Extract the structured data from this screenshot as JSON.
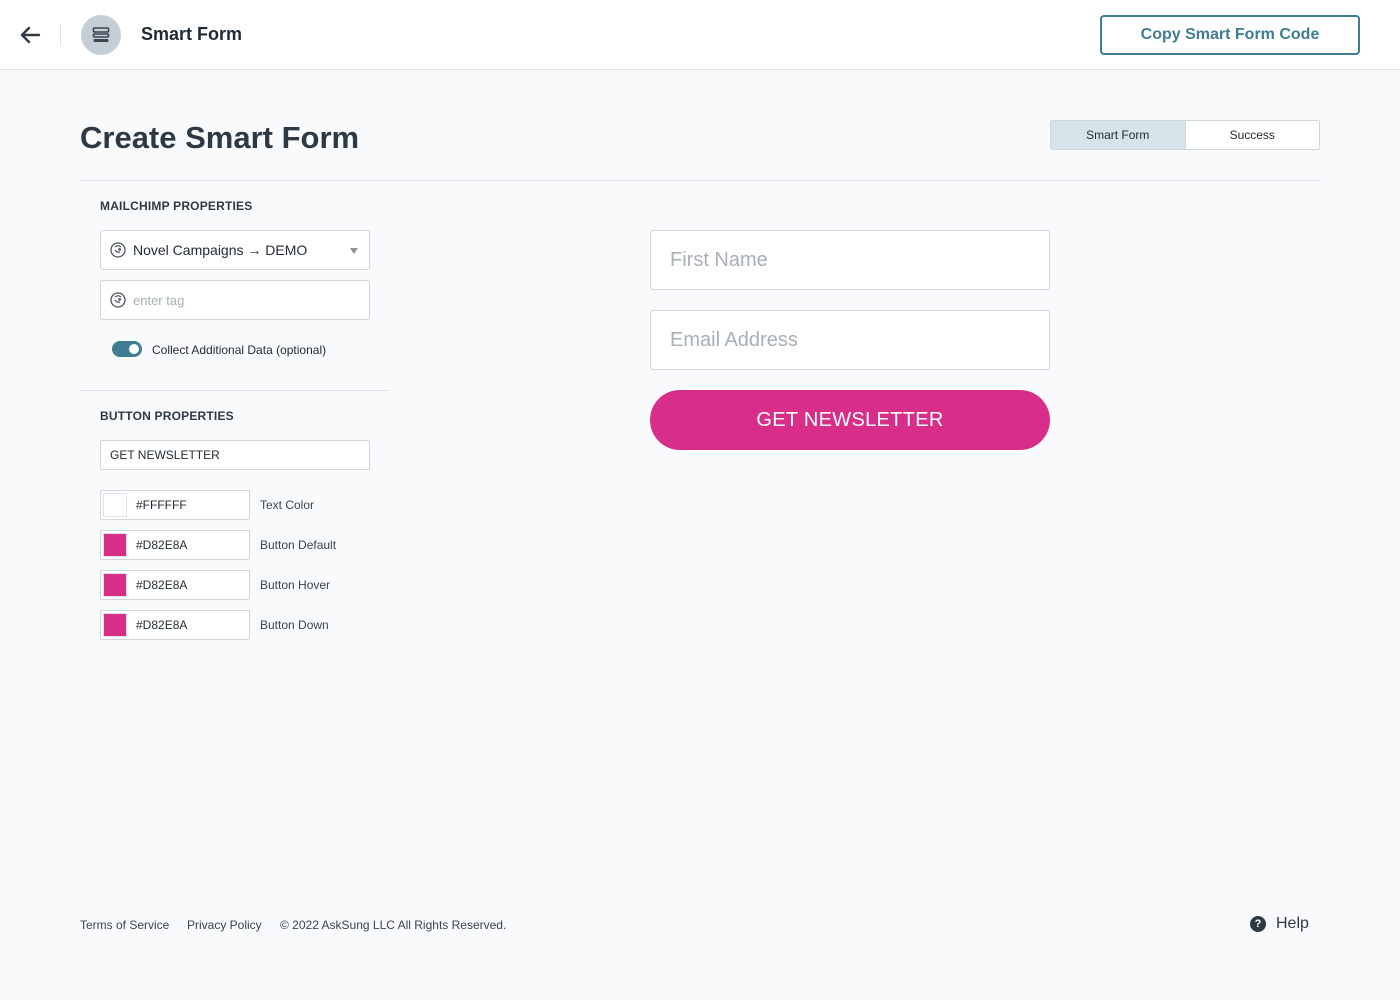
{
  "header": {
    "title": "Smart Form",
    "copy_button_label": "Copy Smart Form Code"
  },
  "page": {
    "title": "Create Smart Form",
    "tabs": [
      {
        "label": "Smart Form",
        "active": true
      },
      {
        "label": "Success",
        "active": false
      }
    ]
  },
  "mailchimp": {
    "section_title": "MAILCHIMP PROPERTIES",
    "audience_value": "Novel Campaigns → DEMO",
    "tag_placeholder": "enter tag",
    "tag_value": "",
    "collect_toggle_label": "Collect Additional Data (optional)",
    "collect_toggle_on": true
  },
  "button_props": {
    "section_title": "BUTTON PROPERTIES",
    "button_text_value": "GET NEWSLETTER",
    "colors": [
      {
        "hex": "#FFFFFF",
        "label": "Text Color"
      },
      {
        "hex": "#D82E8A",
        "label": "Button Default"
      },
      {
        "hex": "#D82E8A",
        "label": "Button Hover"
      },
      {
        "hex": "#D82E8A",
        "label": "Button Down"
      }
    ]
  },
  "preview": {
    "first_name_placeholder": "First Name",
    "email_placeholder": "Email Address",
    "button_label": "GET NEWSLETTER",
    "button_bg": "#D82E8A",
    "button_text_color": "#FFFFFF"
  },
  "footer": {
    "terms": "Terms of Service",
    "privacy": "Privacy Policy",
    "copyright": "© 2022 AskSung LLC All Rights Reserved.",
    "help": "Help"
  },
  "theme": {
    "accent": "#3E7D92",
    "page_bg": "#F9FAFB"
  },
  "icons": {
    "back": "arrow-left-icon",
    "app": "form-layout-icon",
    "mailchimp": "mailchimp-icon",
    "dropdown": "chevron-down-icon",
    "help": "question-circle-icon"
  }
}
